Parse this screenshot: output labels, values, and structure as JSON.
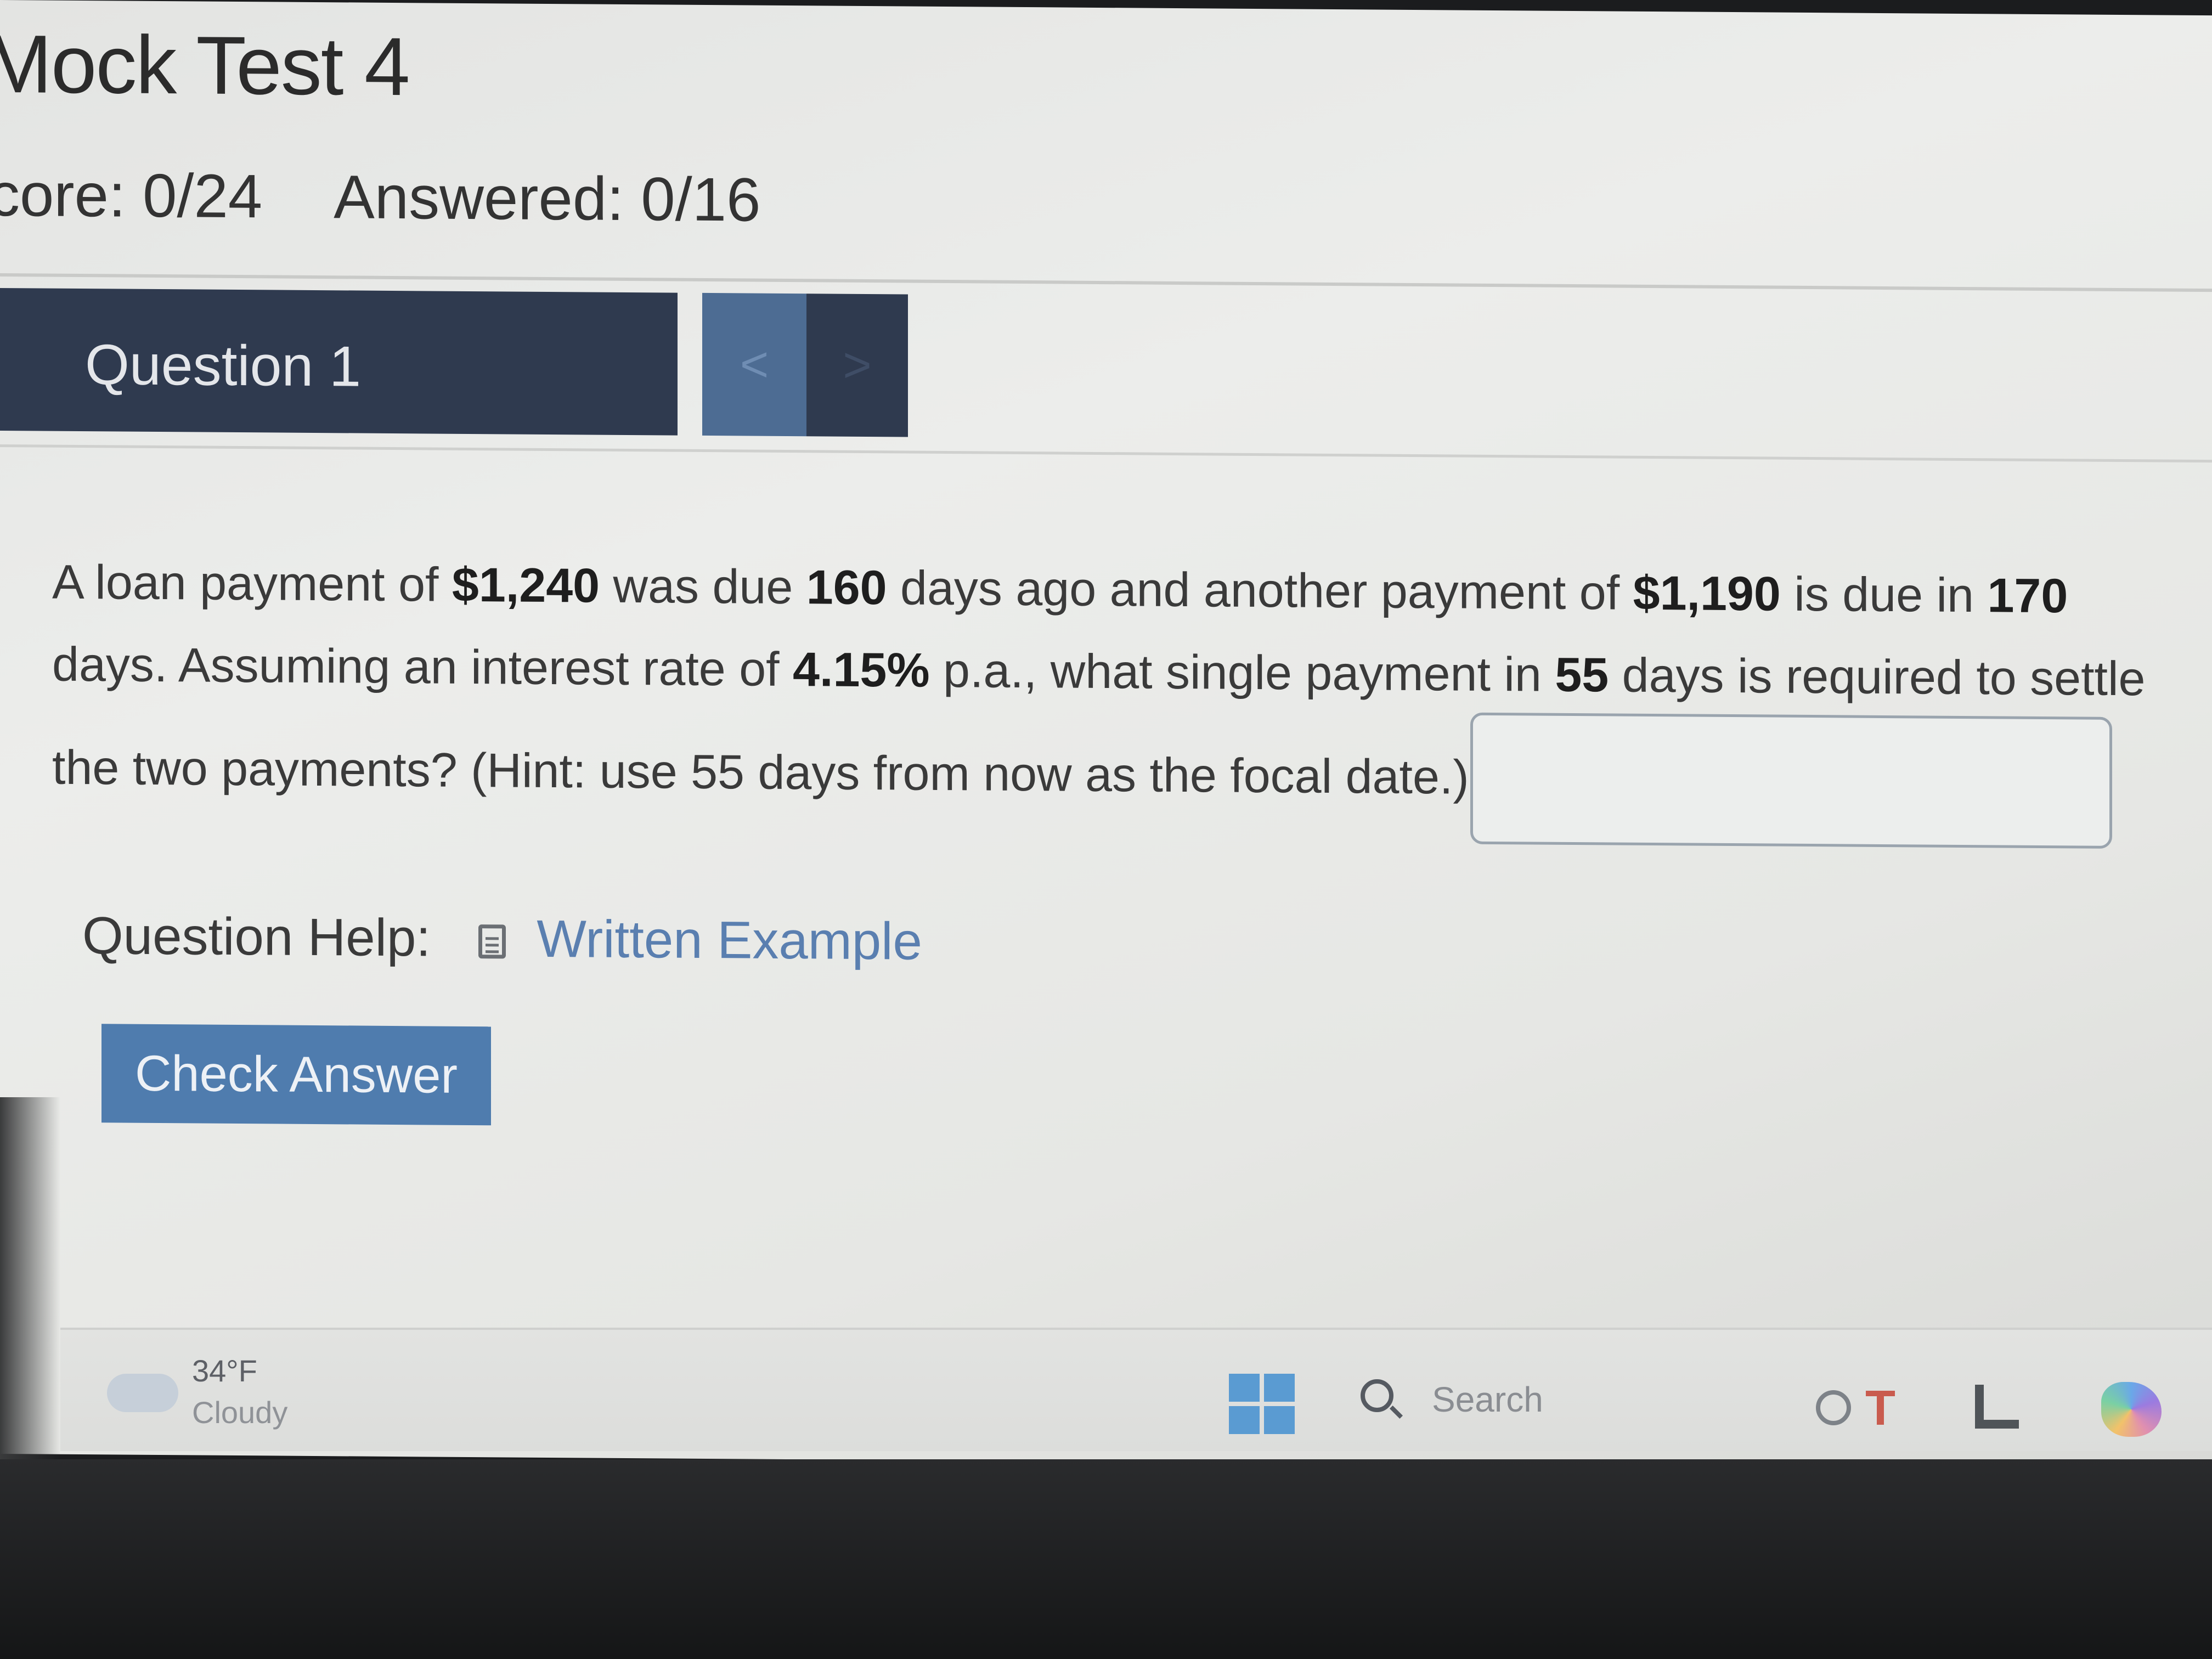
{
  "header": {
    "title": "Mock Test 4",
    "score": "core: 0/24",
    "answered": "Answered: 0/16"
  },
  "question_nav": {
    "label": "Question 1",
    "prev_symbol": "<",
    "next_symbol": ">"
  },
  "question": {
    "line1": {
      "t1": "A loan payment of ",
      "amount1": "$1,240",
      "t2": " was due ",
      "days1": "160",
      "t3": " days ago and another payment of ",
      "amount2": "$1,190",
      "t4": " is due in ",
      "days2": "170"
    },
    "line2": {
      "t1": "days. Assuming an interest rate of ",
      "rate": "4.15%",
      "t2": " p.a., what single payment in ",
      "days3": "55",
      "t3": " days is required to settle"
    },
    "line3": "the two payments? (Hint: use 55 days from now as the focal date.) $",
    "answer_value": ""
  },
  "help": {
    "label": "Question Help:",
    "link": "Written Example"
  },
  "actions": {
    "check_answer": "Check Answer"
  },
  "taskbar": {
    "temperature": "34°F",
    "condition": "Cloudy",
    "search_label": "Search",
    "icons": [
      "weather-icon",
      "windows-start-icon",
      "search-icon",
      "clock-icon",
      "app-t-icon",
      "app-l-icon",
      "copilot-icon"
    ]
  }
}
